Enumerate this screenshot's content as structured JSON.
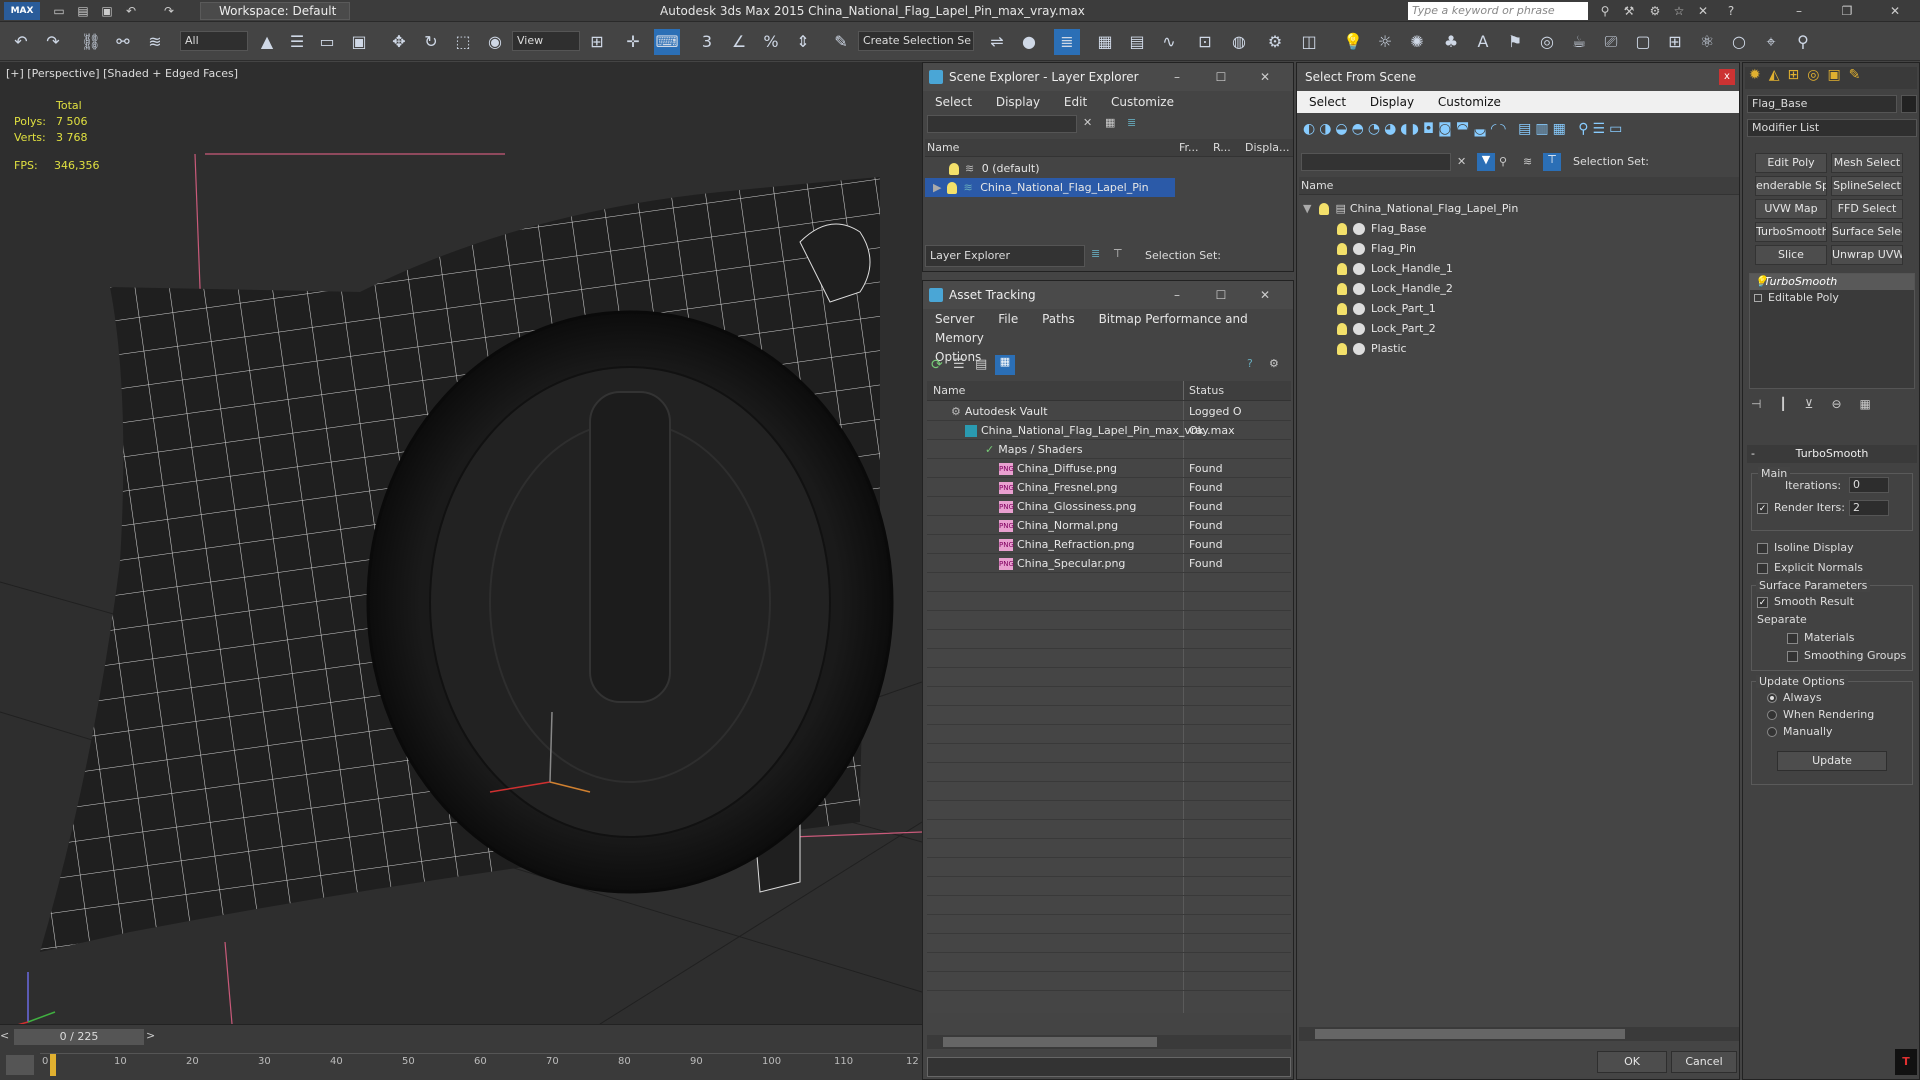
{
  "app": {
    "title": "Autodesk 3ds Max  2015     China_National_Flag_Lapel_Pin_max_vray.max",
    "logo": "MAX",
    "workspace": "Workspace: Default",
    "search_placeholder": "Type a keyword or phrase"
  },
  "toolbar": {
    "filter": "All",
    "ref_coord": "View",
    "selection_set": "Create Selection Se"
  },
  "viewport": {
    "label": "[+] [Perspective] [Shaded + Edged Faces]",
    "stats_header": "Total",
    "polys_label": "Polys:",
    "polys_value": "7 506",
    "verts_label": "Verts:",
    "verts_value": "3 768",
    "fps_label": "FPS:",
    "fps_value": "346,356"
  },
  "timeline": {
    "frame": "0 / 225",
    "ticks": [
      "0",
      "10",
      "20",
      "30",
      "40",
      "50",
      "60",
      "70",
      "80",
      "90",
      "100",
      "110",
      "12"
    ]
  },
  "scene_explorer": {
    "title": "Scene Explorer - Layer Explorer",
    "menu": [
      "Select",
      "Display",
      "Edit",
      "Customize"
    ],
    "columns": [
      "Name",
      "Fr...",
      "R...",
      "Displa..."
    ],
    "rows": [
      {
        "name": "0 (default)"
      },
      {
        "name": "China_National_Flag_Lapel_Pin"
      }
    ],
    "footer_dropdown": "Layer Explorer",
    "selection_set_label": "Selection Set:"
  },
  "asset_tracking": {
    "title": "Asset Tracking",
    "menu": [
      "Server",
      "File",
      "Paths",
      "Bitmap Performance and Memory"
    ],
    "menu2": "Options",
    "columns": [
      "Name",
      "Status"
    ],
    "rows": [
      {
        "name": "Autodesk Vault",
        "status": "Logged O"
      },
      {
        "name": "China_National_Flag_Lapel_Pin_max_vray.max",
        "status": "Ok"
      },
      {
        "name": "Maps / Shaders",
        "status": ""
      },
      {
        "name": "China_Diffuse.png",
        "status": "Found"
      },
      {
        "name": "China_Fresnel.png",
        "status": "Found"
      },
      {
        "name": "China_Glossiness.png",
        "status": "Found"
      },
      {
        "name": "China_Normal.png",
        "status": "Found"
      },
      {
        "name": "China_Refraction.png",
        "status": "Found"
      },
      {
        "name": "China_Specular.png",
        "status": "Found"
      }
    ]
  },
  "select_from_scene": {
    "title": "Select From Scene",
    "menu": [
      "Select",
      "Display",
      "Customize"
    ],
    "selection_set_label": "Selection Set:",
    "column": "Name",
    "root": "China_National_Flag_Lapel_Pin",
    "items": [
      "Flag_Base",
      "Flag_Pin",
      "Lock_Handle_1",
      "Lock_Handle_2",
      "Lock_Part_1",
      "Lock_Part_2",
      "Plastic"
    ],
    "ok": "OK",
    "cancel": "Cancel"
  },
  "command_panel": {
    "object_name": "Flag_Base",
    "modifier_list": "Modifier List",
    "buttons": [
      "Edit Poly",
      "Mesh Select",
      "enderable Splir",
      "SplineSelect",
      "UVW Map",
      "FFD Select",
      "TurboSmooth",
      "Surface Select",
      "Slice",
      "Unwrap UVW"
    ],
    "stack": [
      "TurboSmooth",
      "Editable Poly"
    ],
    "rollout_title": "TurboSmooth",
    "main_label": "Main",
    "iterations_label": "Iterations:",
    "iterations_value": "0",
    "render_iters_label": "Render Iters:",
    "render_iters_value": "2",
    "isoline": "Isoline Display",
    "explicit": "Explicit Normals",
    "surface_label": "Surface Parameters",
    "smooth_result": "Smooth Result",
    "separate": "Separate",
    "materials": "Materials",
    "smoothing_groups": "Smoothing Groups",
    "update_label": "Update Options",
    "always": "Always",
    "when_rendering": "When Rendering",
    "manually": "Manually",
    "update_btn": "Update"
  }
}
